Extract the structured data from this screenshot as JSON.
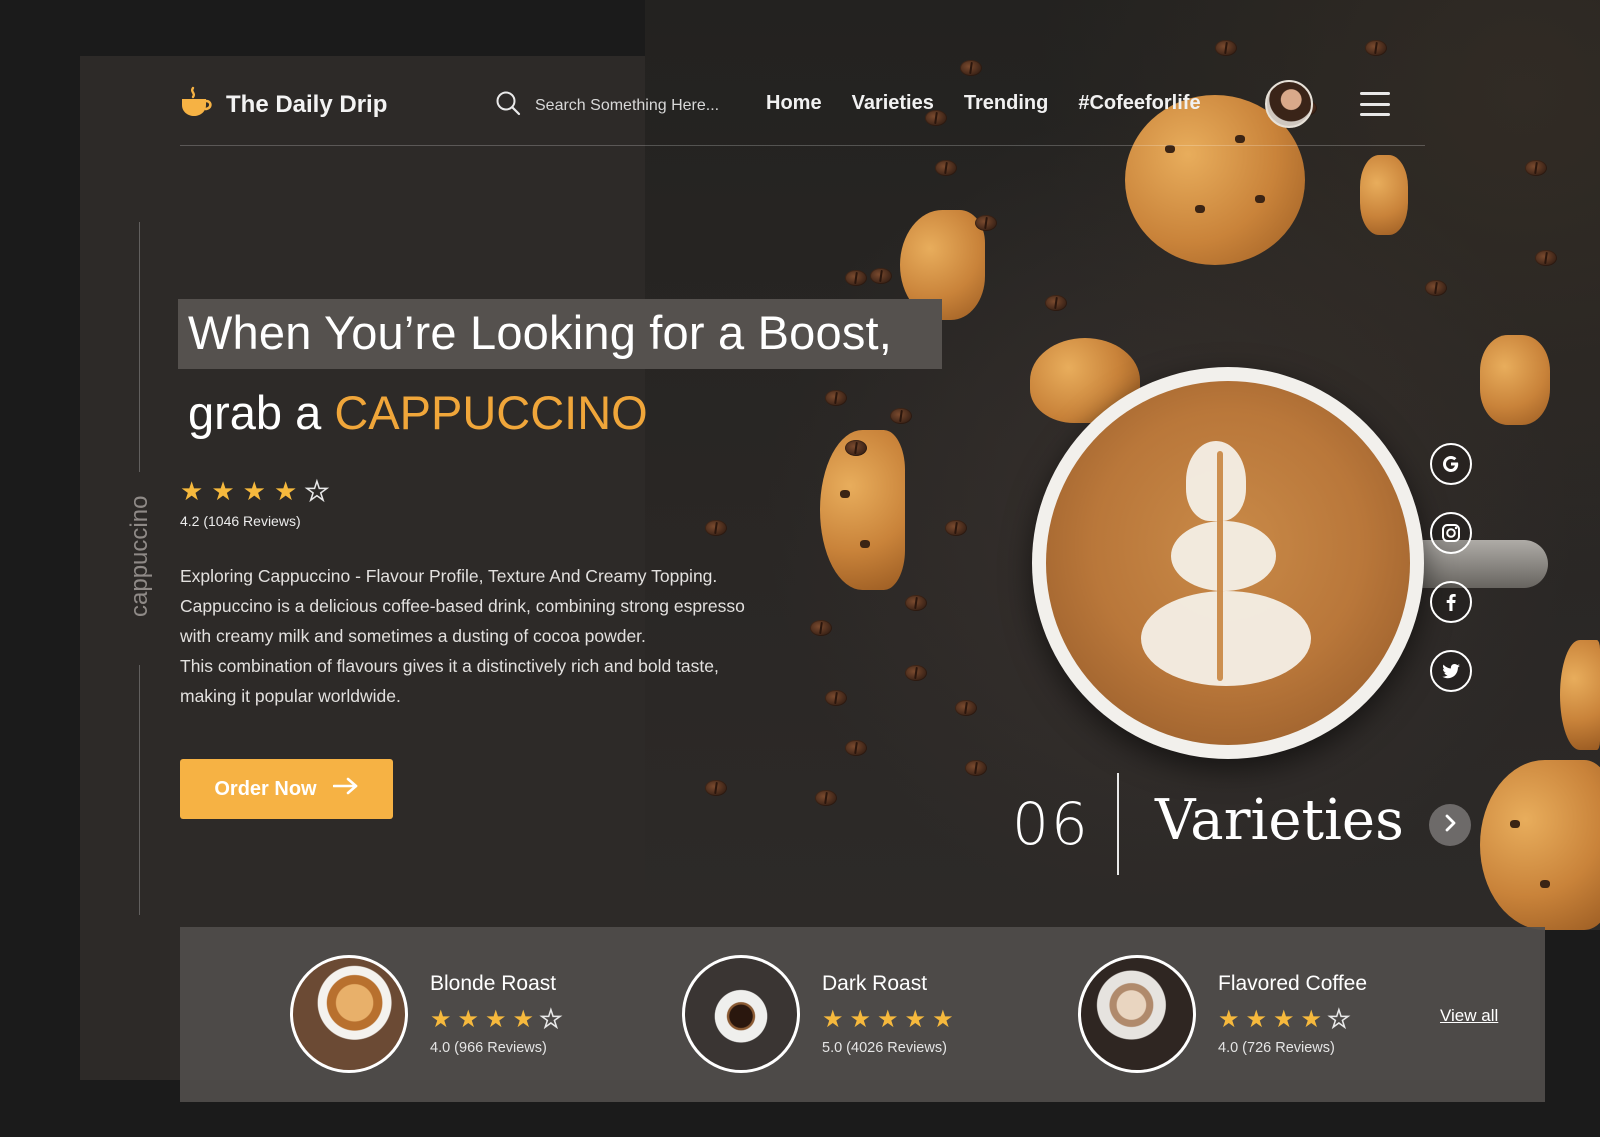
{
  "brand": {
    "name": "The Daily Drip",
    "icon": "coffee-cup-icon",
    "accent": "#f0a63a"
  },
  "search": {
    "placeholder": "Search Something Here..."
  },
  "nav": [
    {
      "label": "Home"
    },
    {
      "label": "Varieties"
    },
    {
      "label": "Trending"
    },
    {
      "label": "#Cofeeforlife"
    }
  ],
  "side_label": "cappuccino",
  "hero": {
    "headline": "When You’re Looking for a Boost,",
    "subline_prefix": "grab a ",
    "subline_accent": "CAPPUCCINO",
    "stars_filled": 4,
    "stars_total": 5,
    "rating_text": "4.2 (1046 Reviews)",
    "description": [
      "Exploring Cappuccino - Flavour Profile, Texture And Creamy Topping.",
      "Cappuccino is a delicious coffee-based drink, combining strong espresso",
      "with creamy milk and sometimes a dusting of cocoa powder.",
      "This combination of flavours gives it a distinctively rich and bold taste,",
      "making it popular worldwide."
    ],
    "cta_label": "Order Now"
  },
  "social": [
    "google-icon",
    "instagram-icon",
    "facebook-icon",
    "twitter-icon"
  ],
  "varieties": {
    "count": "06",
    "label": "Varieties",
    "view_all": "View all",
    "items": [
      {
        "name": "Blonde Roast",
        "stars_filled": 4,
        "rating_text": "4.0 (966 Reviews)"
      },
      {
        "name": "Dark Roast",
        "stars_filled": 5,
        "rating_text": "5.0 (4026 Reviews)"
      },
      {
        "name": "Flavored Coffee",
        "stars_filled": 4,
        "rating_text": "4.0 (726 Reviews)"
      }
    ]
  }
}
